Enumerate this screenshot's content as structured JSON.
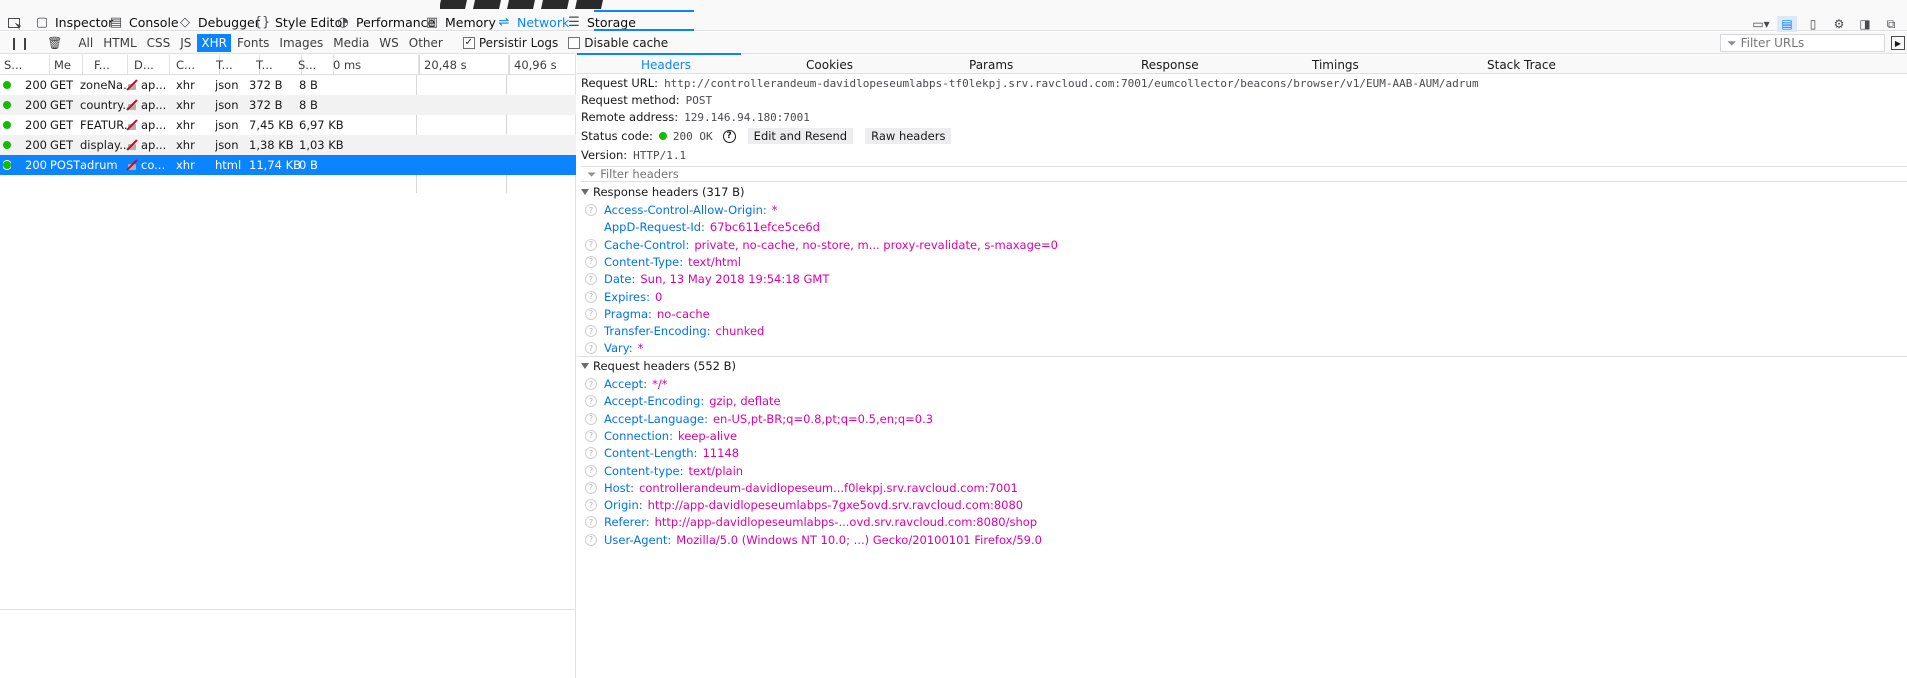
{
  "toolbar": {
    "tools": [
      {
        "label": "Inspector",
        "icon": "inspector-icon",
        "glyph": "▢"
      },
      {
        "label": "Console",
        "icon": "console-icon",
        "glyph": "▤"
      },
      {
        "label": "Debugger",
        "icon": "debugger-icon",
        "glyph": "◇"
      },
      {
        "label": "Style Editor",
        "icon": "style-editor-icon",
        "glyph": "{}"
      },
      {
        "label": "Performance",
        "icon": "performance-icon",
        "glyph": "◔"
      },
      {
        "label": "Memory",
        "icon": "memory-icon",
        "glyph": "▥"
      },
      {
        "label": "Network",
        "icon": "network-icon",
        "glyph": "⇌"
      },
      {
        "label": "Storage",
        "icon": "storage-icon",
        "glyph": "☰"
      }
    ],
    "selected": "Network"
  },
  "filterbar": {
    "types": [
      "All",
      "HTML",
      "CSS",
      "JS",
      "XHR",
      "Fonts",
      "Images",
      "Media",
      "WS",
      "Other"
    ],
    "selected_type": "XHR",
    "persist_logs": {
      "label": "Persistir Logs",
      "checked": true
    },
    "disable_cache": {
      "label": "Disable cache",
      "checked": false
    },
    "filter_urls_placeholder": "Filter URLs"
  },
  "requests": {
    "columns": [
      "S...",
      "Me",
      "F...",
      "D...",
      "C...",
      "T...",
      "T...",
      "S..."
    ],
    "waterfall_ticks": [
      "0 ms",
      "20,48 s",
      "40,96 s"
    ],
    "rows": [
      {
        "status": "200",
        "method": "GET",
        "file": "zoneNa...",
        "domain": "ap...",
        "cause": "xhr",
        "type": "json",
        "transferred": "372 B",
        "size": "8 B"
      },
      {
        "status": "200",
        "method": "GET",
        "file": "country...",
        "domain": "ap...",
        "cause": "xhr",
        "type": "json",
        "transferred": "372 B",
        "size": "8 B"
      },
      {
        "status": "200",
        "method": "GET",
        "file": "FEATUR...",
        "domain": "ap...",
        "cause": "xhr",
        "type": "json",
        "transferred": "7,45 KB",
        "size": "6,97 KB"
      },
      {
        "status": "200",
        "method": "GET",
        "file": "display...",
        "domain": "ap...",
        "cause": "xhr",
        "type": "json",
        "transferred": "1,38 KB",
        "size": "1,03 KB"
      },
      {
        "status": "200",
        "method": "POST",
        "file": "adrum",
        "domain": "co...",
        "cause": "xhr",
        "type": "html",
        "transferred": "11,74 KB",
        "size": "0 B"
      }
    ],
    "selected_index": 4
  },
  "detail": {
    "tabs": [
      "Headers",
      "Cookies",
      "Params",
      "Response",
      "Timings",
      "Stack Trace"
    ],
    "selected_tab": "Headers",
    "request_url_label": "Request URL:",
    "request_url": "http://controllerandeum-davidlopeseumlabps-tf0lekpj.srv.ravcloud.com:7001/eumcollector/beacons/browser/v1/EUM-AAB-AUM/adrum",
    "request_method_label": "Request method:",
    "request_method": "POST",
    "remote_address_label": "Remote address:",
    "remote_address": "129.146.94.180:7001",
    "status_code_label": "Status code:",
    "status_code": "200 OK",
    "edit_resend_label": "Edit and Resend",
    "raw_headers_label": "Raw headers",
    "version_label": "Version:",
    "version": "HTTP/1.1",
    "filter_headers_placeholder": "Filter headers",
    "response_headers_title": "Response headers (317 B)",
    "response_headers": [
      {
        "name": "Access-Control-Allow-Origin:",
        "value": "*",
        "help": true
      },
      {
        "name": "AppD-Request-Id:",
        "value": "67bc611efce5ce6d",
        "help": false
      },
      {
        "name": "Cache-Control:",
        "value": "private, no-cache, no-store, m... proxy-revalidate, s-maxage=0",
        "help": true
      },
      {
        "name": "Content-Type:",
        "value": "text/html",
        "help": true
      },
      {
        "name": "Date:",
        "value": "Sun, 13 May 2018 19:54:18 GMT",
        "help": true
      },
      {
        "name": "Expires:",
        "value": "0",
        "help": true
      },
      {
        "name": "Pragma:",
        "value": "no-cache",
        "help": true
      },
      {
        "name": "Transfer-Encoding:",
        "value": "chunked",
        "help": true
      },
      {
        "name": "Vary:",
        "value": "*",
        "help": true
      }
    ],
    "request_headers_title": "Request headers (552 B)",
    "request_headers": [
      {
        "name": "Accept:",
        "value": "*/*",
        "help": true
      },
      {
        "name": "Accept-Encoding:",
        "value": "gzip, deflate",
        "help": true
      },
      {
        "name": "Accept-Language:",
        "value": "en-US,pt-BR;q=0.8,pt;q=0.5,en;q=0.3",
        "help": true
      },
      {
        "name": "Connection:",
        "value": "keep-alive",
        "help": true
      },
      {
        "name": "Content-Length:",
        "value": "11148",
        "help": true
      },
      {
        "name": "Content-type:",
        "value": "text/plain",
        "help": true
      },
      {
        "name": "Host:",
        "value": "controllerandeum-davidlopeseum...f0lekpj.srv.ravcloud.com:7001",
        "help": true
      },
      {
        "name": "Origin:",
        "value": "http://app-davidlopeseumlabps-7gxe5ovd.srv.ravcloud.com:8080",
        "help": true
      },
      {
        "name": "Referer:",
        "value": "http://app-davidlopeseumlabps-...ovd.srv.ravcloud.com:8080/shop",
        "help": true
      },
      {
        "name": "User-Agent:",
        "value": "Mozilla/5.0 (Windows NT 10.0; ...) Gecko/20100101 Firefox/59.0",
        "help": true
      }
    ]
  },
  "colors": {
    "accent": "#0a84ff",
    "status_ok": "#12bc00",
    "header_name": "#0074e8",
    "header_value": "#dd00a9"
  }
}
